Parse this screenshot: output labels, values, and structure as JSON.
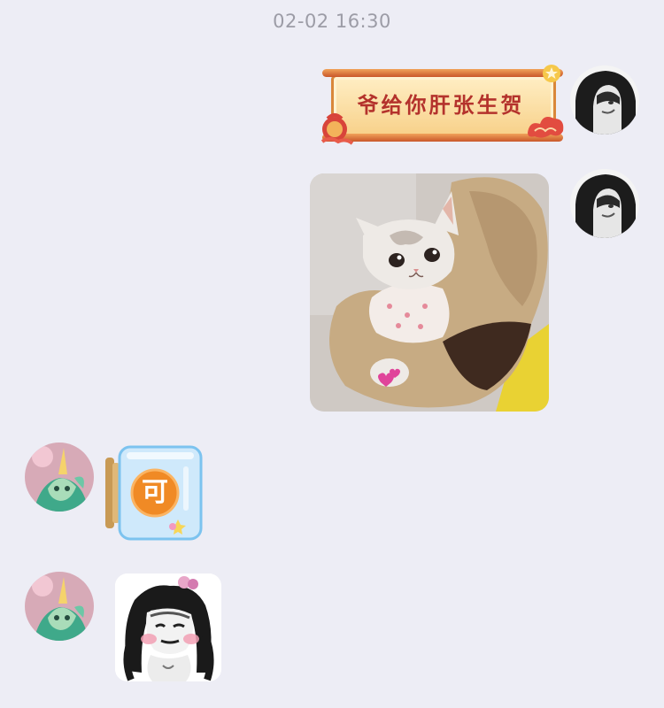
{
  "chat": {
    "timestamp": "02-02 16:30"
  },
  "messages": [
    {
      "sender": "self",
      "type": "sticker",
      "sticker_text": "爷给你肝张生贺"
    },
    {
      "sender": "self",
      "type": "image",
      "image_subject": "kitten"
    },
    {
      "sender": "other",
      "type": "sticker",
      "sticker_text": "可"
    },
    {
      "sender": "other",
      "type": "sticker",
      "sticker_text": ""
    }
  ],
  "colors": {
    "background": "#ededf5",
    "timestamp_text": "#9c9ca6",
    "banner_text": "#b4322c",
    "jar_badge": "#f08a25"
  }
}
